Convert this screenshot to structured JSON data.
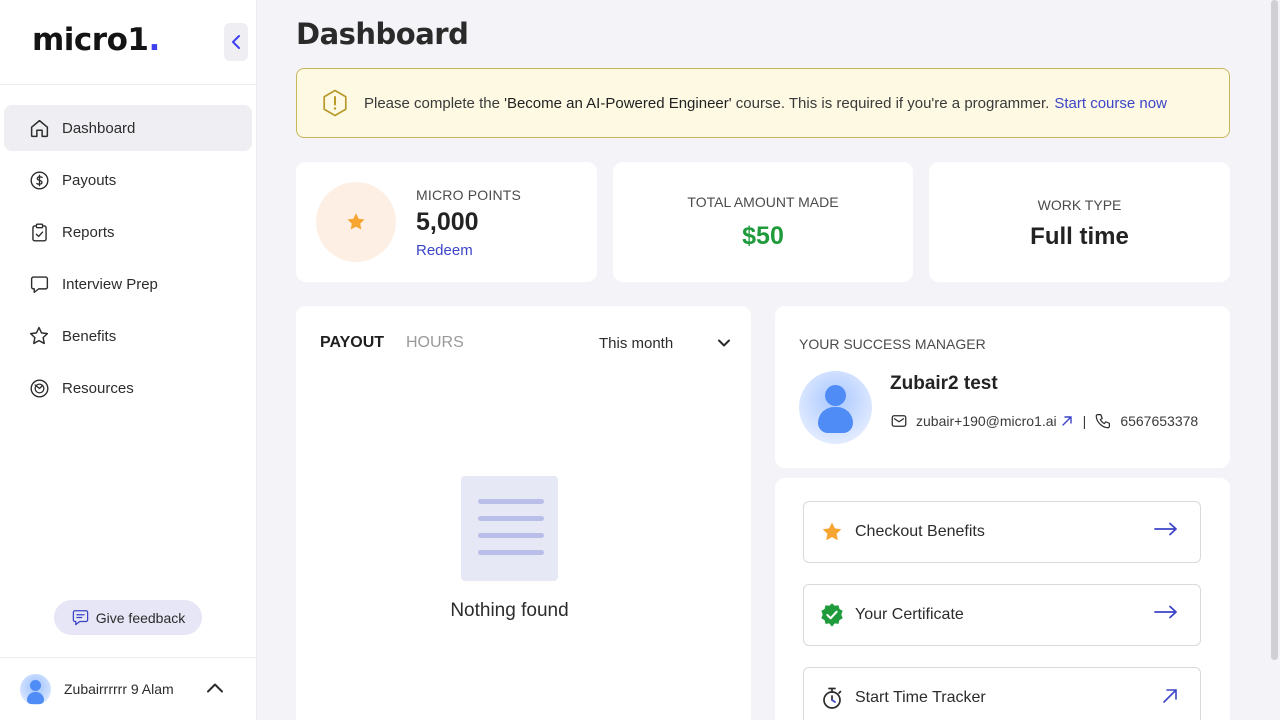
{
  "sidebar": {
    "logo_text": "micro1",
    "logo_dot": ".",
    "items": [
      {
        "label": "Dashboard",
        "icon": "home-icon",
        "active": true
      },
      {
        "label": "Payouts",
        "icon": "dollar-icon"
      },
      {
        "label": "Reports",
        "icon": "clipboard-icon"
      },
      {
        "label": "Interview Prep",
        "icon": "chat-icon"
      },
      {
        "label": "Benefits",
        "icon": "star-icon"
      },
      {
        "label": "Resources",
        "icon": "resources-icon"
      }
    ],
    "feedback_label": "Give feedback",
    "user_name": "Zubairrrrrr 9 Alam"
  },
  "page": {
    "title": "Dashboard"
  },
  "alert": {
    "prefix": "Please complete the ",
    "course": "'Become an AI-Powered Engineer'",
    "suffix": " course. This is required if you're a programmer.",
    "link": "Start course now"
  },
  "stats": {
    "points_label": "MICRO POINTS",
    "points_value": "5,000",
    "redeem_label": "Redeem",
    "amount_label": "TOTAL AMOUNT MADE",
    "amount_value": "$50",
    "worktype_label": "WORK TYPE",
    "worktype_value": "Full time"
  },
  "payout": {
    "tabs": [
      "PAYOUT",
      "HOURS"
    ],
    "period": "This month",
    "empty_text": "Nothing found"
  },
  "manager": {
    "label": "YOUR SUCCESS MANAGER",
    "name": "Zubair2 test",
    "email": "zubair+190@micro1.ai",
    "separator": "|",
    "phone": "6567653378"
  },
  "actions": [
    {
      "label": "Checkout Benefits"
    },
    {
      "label": "Your Certificate"
    },
    {
      "label": "Start Time Tracker"
    }
  ],
  "colors": {
    "accent": "#3c45c7",
    "success": "#1f9b3c",
    "star": "#f7a531",
    "alert_bg": "#fdf9e3"
  }
}
